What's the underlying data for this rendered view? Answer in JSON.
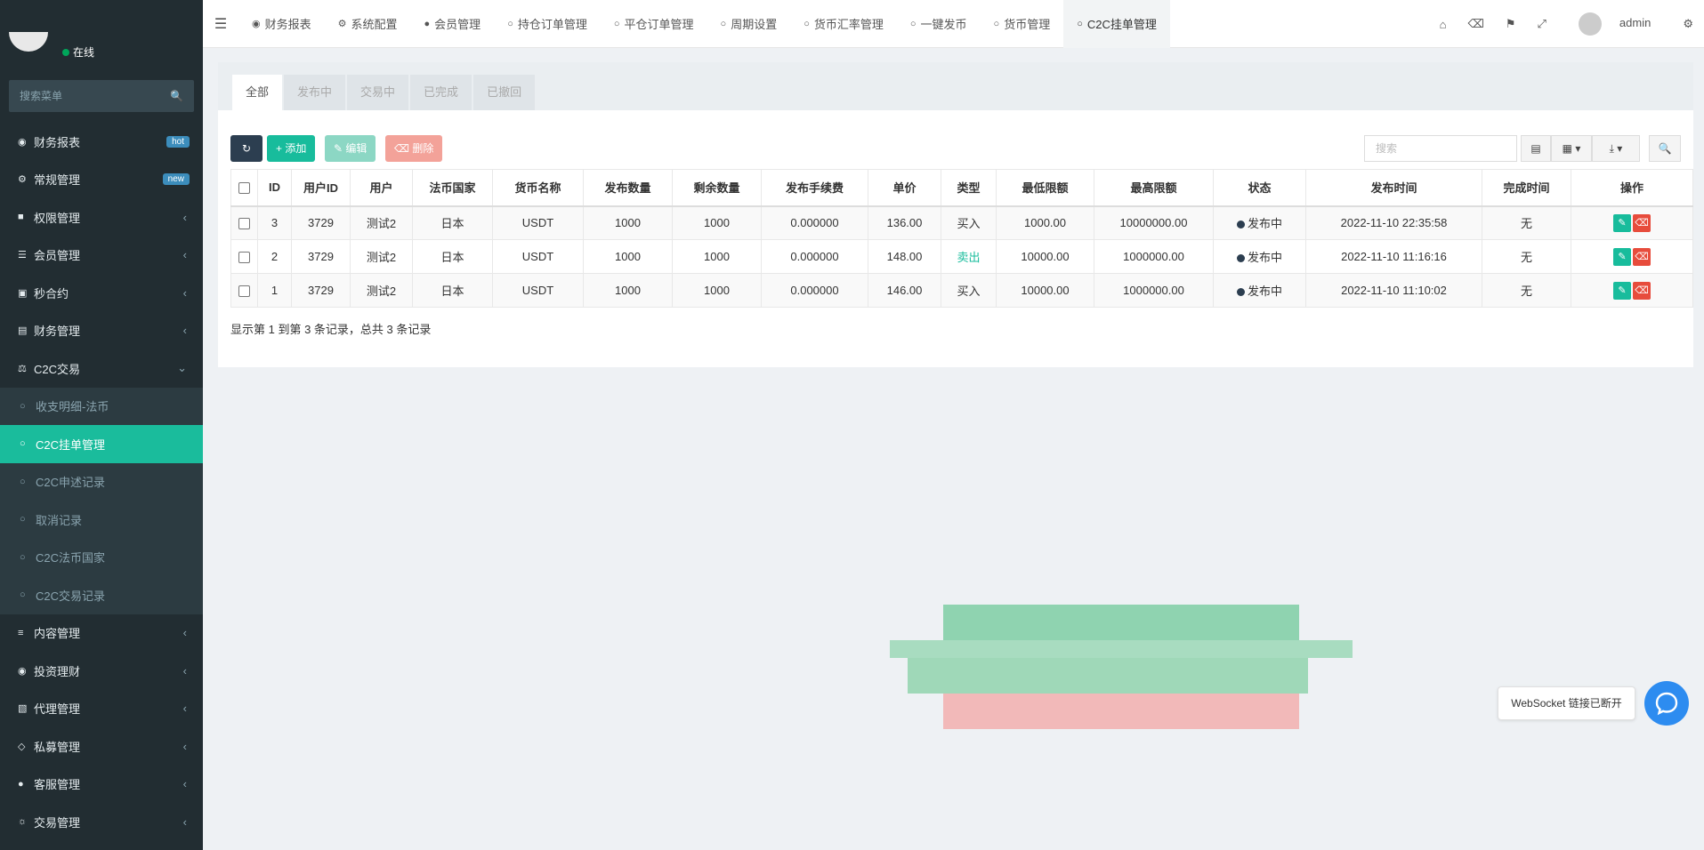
{
  "sidebar": {
    "status": "在线",
    "search_placeholder": "搜索菜单",
    "items": [
      {
        "label": "财务报表",
        "icon": "dashboard-icon",
        "badge": "hot"
      },
      {
        "label": "常规管理",
        "icon": "cogs-icon",
        "badge": "new"
      },
      {
        "label": "权限管理",
        "icon": "group-icon"
      },
      {
        "label": "会员管理",
        "icon": "list-icon"
      },
      {
        "label": "秒合约",
        "icon": "calendar-icon"
      },
      {
        "label": "财务管理",
        "icon": "database-icon"
      },
      {
        "label": "C2C交易",
        "icon": "balance-scale-icon"
      },
      {
        "label": "收支明细-法币",
        "sub": true
      },
      {
        "label": "C2C挂单管理",
        "sub": true,
        "active": true
      },
      {
        "label": "C2C申述记录",
        "sub": true
      },
      {
        "label": "取消记录",
        "sub": true
      },
      {
        "label": "C2C法币国家",
        "sub": true
      },
      {
        "label": "C2C交易记录",
        "sub": true
      },
      {
        "label": "内容管理",
        "icon": "align-icon"
      },
      {
        "label": "投资理财",
        "icon": "compass-icon"
      },
      {
        "label": "代理管理",
        "icon": "briefcase-icon"
      },
      {
        "label": "私募管理",
        "icon": "diamond-icon"
      },
      {
        "label": "客服管理",
        "icon": "comment-icon"
      },
      {
        "label": "交易管理",
        "icon": "handshake-icon"
      }
    ]
  },
  "topbar": {
    "tabs": [
      {
        "label": "财务报表",
        "icon": "dashboard-icon"
      },
      {
        "label": "系统配置",
        "icon": "cog-icon"
      },
      {
        "label": "会员管理",
        "icon": "user-icon"
      },
      {
        "label": "持仓订单管理",
        "icon": "circle-icon"
      },
      {
        "label": "平仓订单管理",
        "icon": "circle-icon"
      },
      {
        "label": "周期设置",
        "icon": "circle-icon"
      },
      {
        "label": "货币汇率管理",
        "icon": "circle-icon"
      },
      {
        "label": "一键发币",
        "icon": "circle-icon"
      },
      {
        "label": "货币管理",
        "icon": "circle-icon"
      },
      {
        "label": "C2C挂单管理",
        "icon": "circle-icon",
        "active": true
      }
    ],
    "username": "admin"
  },
  "filter_tabs": [
    "全部",
    "发布中",
    "交易中",
    "已完成",
    "已撤回"
  ],
  "toolbar": {
    "add": "添加",
    "edit": "编辑",
    "delete": "删除",
    "search_placeholder": "搜索"
  },
  "table": {
    "headers": [
      "ID",
      "用户ID",
      "用户",
      "法币国家",
      "货币名称",
      "发布数量",
      "剩余数量",
      "发布手续费",
      "单价",
      "类型",
      "最低限额",
      "最高限额",
      "状态",
      "发布时间",
      "完成时间",
      "操作"
    ],
    "rows": [
      [
        "3",
        "3729",
        "测试2",
        "日本",
        "USDT",
        "1000",
        "1000",
        "0.000000",
        "136.00",
        "买入",
        "1000.00",
        "10000000.00",
        "发布中",
        "2022-11-10 22:35:58",
        "无"
      ],
      [
        "2",
        "3729",
        "测试2",
        "日本",
        "USDT",
        "1000",
        "1000",
        "0.000000",
        "148.00",
        "卖出",
        "10000.00",
        "1000000.00",
        "发布中",
        "2022-11-10 11:16:16",
        "无"
      ],
      [
        "1",
        "3729",
        "测试2",
        "日本",
        "USDT",
        "1000",
        "1000",
        "0.000000",
        "146.00",
        "买入",
        "10000.00",
        "1000000.00",
        "发布中",
        "2022-11-10 11:10:02",
        "无"
      ]
    ]
  },
  "pager_text": "显示第 1 到第 3 条记录，总共 3 条记录",
  "websocket_tip": "WebSocket 链接已断开",
  "colors": {
    "sidebar": "#222d32",
    "accent": "#18bc9c",
    "danger": "#e74c3c",
    "primary": "#2c3e50"
  }
}
